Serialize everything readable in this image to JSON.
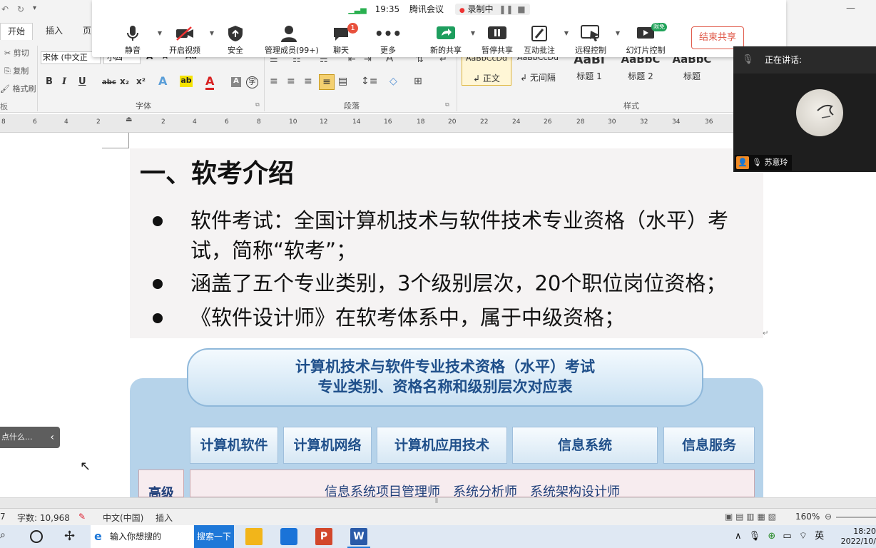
{
  "meeting": {
    "time": "19:35",
    "app_name": "腾讯会议",
    "recording_label": "录制中",
    "buttons": [
      {
        "label": "静音",
        "icon": "microphone-icon"
      },
      {
        "label": "开启视频",
        "icon": "video-off-icon"
      },
      {
        "label": "安全",
        "icon": "shield-icon"
      },
      {
        "label": "管理成员(99+)",
        "icon": "person-icon"
      },
      {
        "label": "聊天",
        "icon": "chat-icon",
        "badge": "1"
      },
      {
        "label": "更多",
        "icon": "more-icon"
      },
      {
        "label": "新的共享",
        "icon": "share-icon"
      },
      {
        "label": "暂停共享",
        "icon": "pause-share-icon"
      },
      {
        "label": "互动批注",
        "icon": "annotate-icon"
      },
      {
        "label": "远程控制",
        "icon": "remote-control-icon"
      },
      {
        "label": "幻灯片控制",
        "icon": "slide-control-icon",
        "badge": "限免"
      }
    ],
    "end_share": "结束共享"
  },
  "word": {
    "tabs": [
      "开始",
      "插入",
      "页"
    ],
    "clipboard": [
      "剪切",
      "复制",
      "格式刷"
    ],
    "font_name": "宋体 (中文正",
    "font_size": "小四",
    "group_labels": {
      "font": "字体",
      "paragraph": "段落",
      "styles": "样式"
    },
    "styles": [
      {
        "preview": "AaBbCcDd",
        "name": "正文"
      },
      {
        "preview": "AaBbCcDd",
        "name": "无间隔"
      },
      {
        "preview": "AaBl",
        "name": "标题 1"
      },
      {
        "preview": "AaBbC",
        "name": "标题 2"
      },
      {
        "preview": "AaBbC",
        "name": "标题"
      }
    ],
    "ruler_numbers": [
      "8",
      "6",
      "4",
      "2",
      "2",
      "4",
      "6",
      "8",
      "10",
      "12",
      "14",
      "16",
      "18",
      "20",
      "22",
      "24",
      "26",
      "28",
      "30",
      "32",
      "34",
      "36"
    ]
  },
  "slide": {
    "title": "一、软考介绍",
    "bullets": [
      "软件考试：全国计算机技术与软件技术专业资格（水平）考试，简称“软考”；",
      "涵盖了五个专业类别，3个级别层次，20个职位岗位资格；",
      "《软件设计师》在软考体系中，属于中级资格；"
    ]
  },
  "table_image": {
    "heading_line1": "计算机技术与软件专业技术资格（水平）考试",
    "heading_line2": "专业类别、资格名称和级别层次对应表",
    "categories": [
      "计算机软件",
      "计算机网络",
      "计算机应用技术",
      "信息系统",
      "信息服务"
    ],
    "level_label": "高级",
    "level_row": "信息系统项目管理师　系统分析师　系统架构设计师"
  },
  "left_panel": {
    "search_hint": "点什么..."
  },
  "video_panel": {
    "speaking_label": "正在讲话:",
    "participant": "苏意玲"
  },
  "statusbar": {
    "page": "7",
    "words": "字数: 10,968",
    "language": "中文(中国)",
    "mode": "插入",
    "zoom": "160%"
  },
  "taskbar": {
    "search_placeholder": "输入你想搜的",
    "search_button": "搜索一下",
    "ime": "英",
    "time": "18:20",
    "date": "2022/10/"
  }
}
